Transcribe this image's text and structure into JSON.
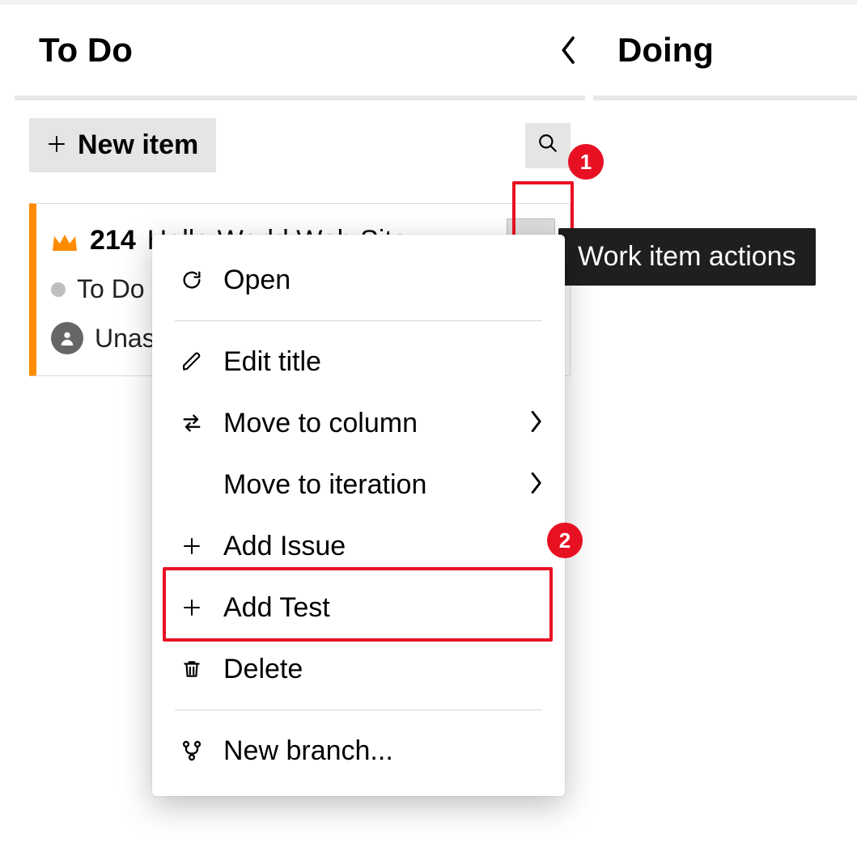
{
  "columns": {
    "todo": {
      "title": "To Do"
    },
    "doing": {
      "title": "Doing"
    }
  },
  "new_item": {
    "label": "New item"
  },
  "card": {
    "id": "214",
    "title": "Hello World Web Site",
    "state": "To Do",
    "assignee": "Unassigned"
  },
  "tooltip": {
    "work_item_actions": "Work item actions"
  },
  "menu": {
    "open": "Open",
    "edit_title": "Edit title",
    "move_to_column": "Move to column",
    "move_to_iteration": "Move to iteration",
    "add_issue": "Add Issue",
    "add_test": "Add Test",
    "delete": "Delete",
    "new_branch": "New branch..."
  },
  "callouts": {
    "one": "1",
    "two": "2"
  }
}
